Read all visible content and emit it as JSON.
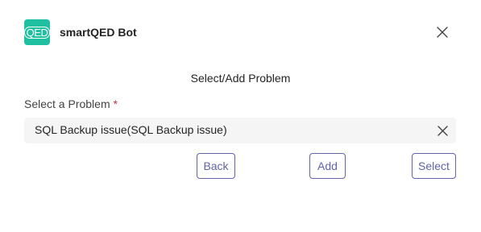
{
  "header": {
    "logo_text": "QED",
    "app_name": "smartQED Bot",
    "close_icon": "close-icon"
  },
  "card": {
    "title": "Select/Add Problem",
    "field_label": "Select a Problem",
    "required_marker": "*",
    "selected_value": "SQL Backup issue(SQL Backup issue)",
    "clear_icon": "clear-icon"
  },
  "actions": {
    "back_label": "Back",
    "add_label": "Add",
    "select_label": "Select"
  },
  "colors": {
    "brand": "#1fbfa2",
    "accent": "#6264a7",
    "required": "#c4314b",
    "field_bg": "#f5f5f5"
  }
}
